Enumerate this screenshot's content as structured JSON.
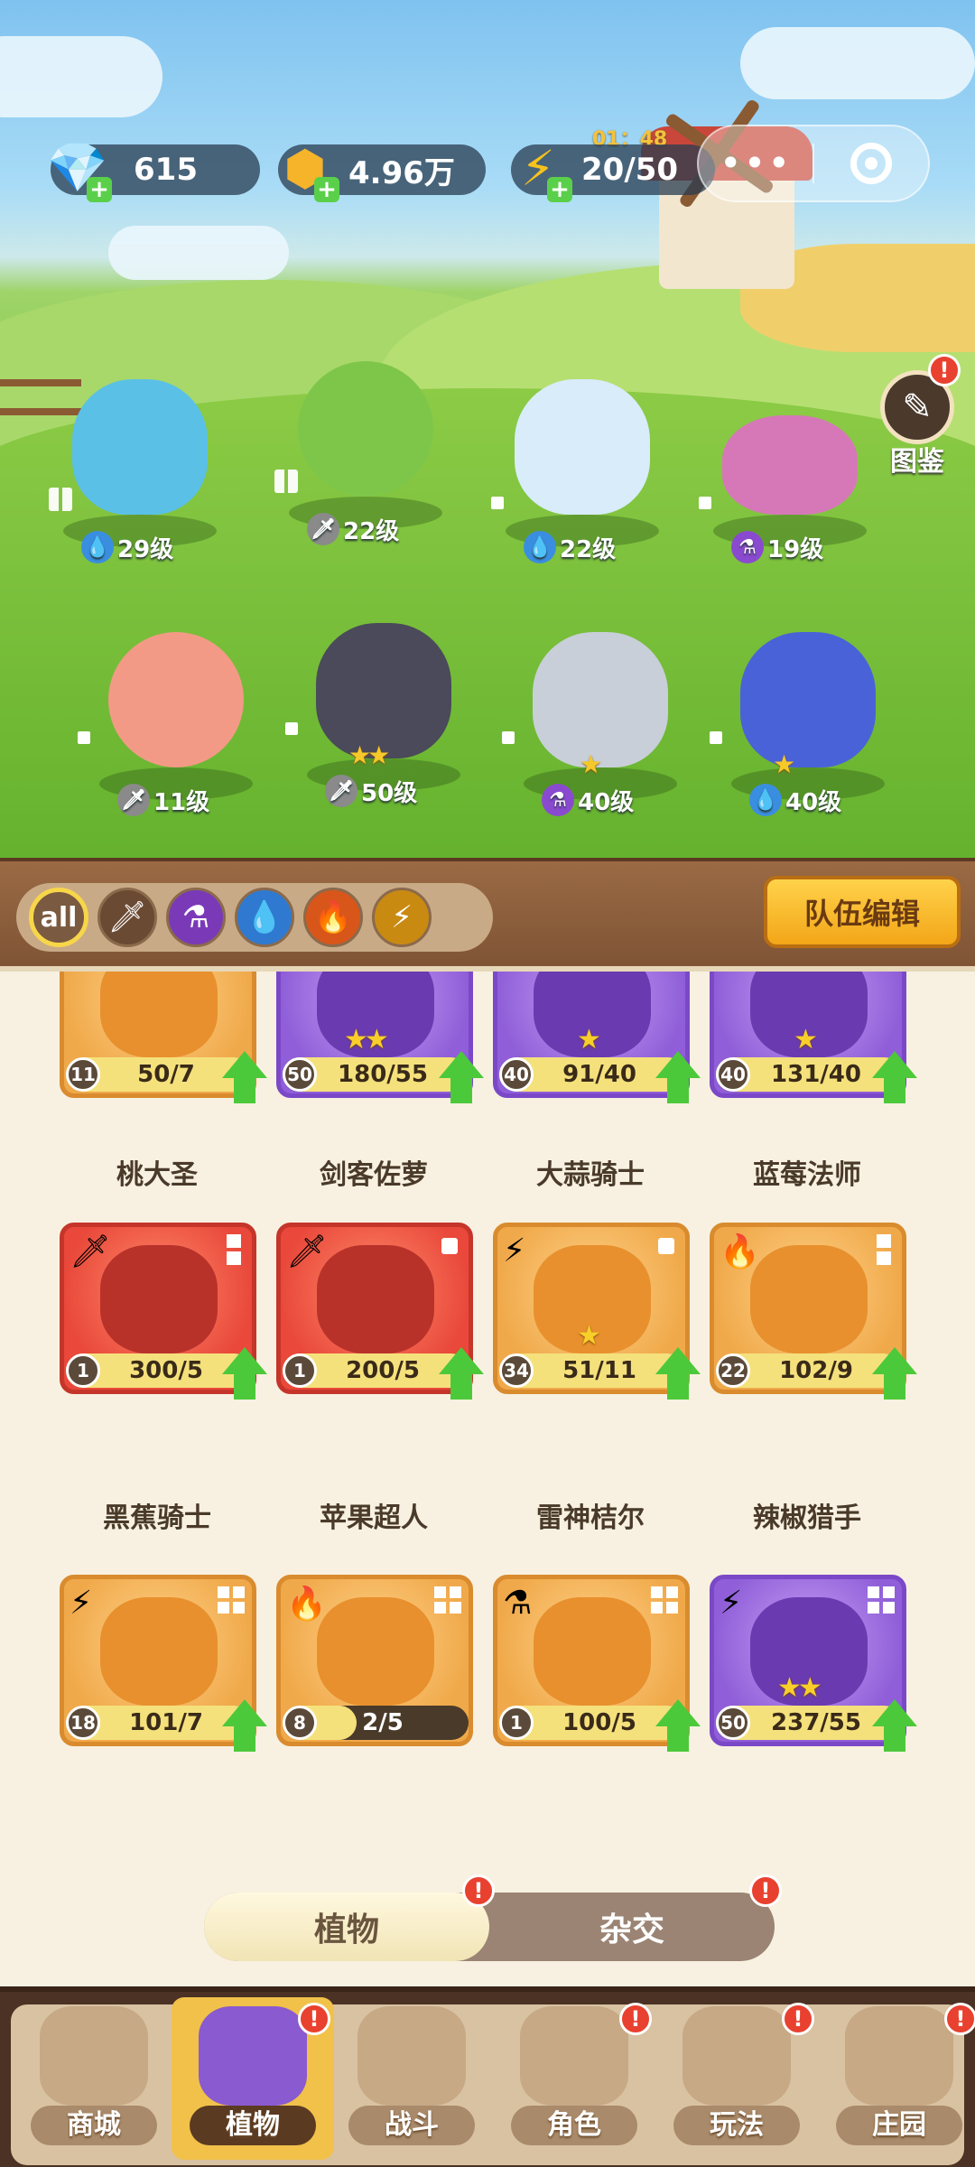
{
  "resources": {
    "gems": "615",
    "gold": "4.96万",
    "energy": "20/50",
    "energy_timer": "01：48"
  },
  "capsule": {
    "more": "•••"
  },
  "tujian": {
    "label": "图鉴",
    "badge": "!"
  },
  "heroes": [
    {
      "level": "29级",
      "element": "water"
    },
    {
      "level": "22级",
      "element": "sword"
    },
    {
      "level": "22级",
      "element": "water"
    },
    {
      "level": "19级",
      "element": "poison"
    },
    {
      "level": "11级",
      "element": "sword"
    },
    {
      "level": "50级",
      "element": "sword",
      "stars": 2
    },
    {
      "level": "40级",
      "element": "poison",
      "stars": 1
    },
    {
      "level": "40级",
      "element": "water",
      "stars": 1
    }
  ],
  "filters": {
    "all": "all",
    "items": [
      "sword",
      "poison",
      "water",
      "fire",
      "lightning"
    ]
  },
  "team_edit": "队伍编辑",
  "cards": [
    {
      "name": "桃大圣",
      "level": "11",
      "count": "50/7",
      "progress": 1.0,
      "color": "orange",
      "stars": 0
    },
    {
      "name": "剑客佐萝",
      "level": "50",
      "count": "180/55",
      "progress": 1.0,
      "color": "purple",
      "stars": 2
    },
    {
      "name": "大蒜骑士",
      "level": "40",
      "count": "91/40",
      "progress": 1.0,
      "color": "purple",
      "stars": 1
    },
    {
      "name": "蓝莓法师",
      "level": "40",
      "count": "131/40",
      "progress": 1.0,
      "color": "purple",
      "stars": 1
    },
    {
      "name": "黑蕉骑士",
      "level": "1",
      "count": "300/5",
      "progress": 1.0,
      "color": "red",
      "stars": 0,
      "element": "sword"
    },
    {
      "name": "苹果超人",
      "level": "1",
      "count": "200/5",
      "progress": 1.0,
      "color": "red",
      "stars": 0,
      "element": "sword"
    },
    {
      "name": "雷神桔尔",
      "level": "34",
      "count": "51/11",
      "progress": 1.0,
      "color": "orange",
      "stars": 1,
      "element": "lightning"
    },
    {
      "name": "辣椒猎手",
      "level": "22",
      "count": "102/9",
      "progress": 1.0,
      "color": "orange",
      "stars": 0,
      "element": "fire"
    },
    {
      "name": "",
      "level": "18",
      "count": "101/7",
      "progress": 1.0,
      "color": "orange",
      "stars": 0,
      "element": "lightning"
    },
    {
      "name": "",
      "level": "8",
      "count": "2/5",
      "progress": 0.4,
      "color": "orange",
      "stars": 0,
      "element": "fire"
    },
    {
      "name": "",
      "level": "1",
      "count": "100/5",
      "progress": 1.0,
      "color": "orange",
      "stars": 0,
      "element": "poison"
    },
    {
      "name": "",
      "level": "50",
      "count": "237/55",
      "progress": 1.0,
      "color": "purple",
      "stars": 2,
      "element": "lightning"
    }
  ],
  "toggle": {
    "plants": "植物",
    "hybrid": "杂交",
    "badge": "!"
  },
  "nav": [
    {
      "label": "商城",
      "badge": ""
    },
    {
      "label": "植物",
      "badge": "!"
    },
    {
      "label": "战斗",
      "badge": ""
    },
    {
      "label": "角色",
      "badge": "!"
    },
    {
      "label": "玩法",
      "badge": "!"
    },
    {
      "label": "庄园",
      "badge": "!"
    }
  ],
  "colors": {
    "accent": "#f3a618",
    "upgrade": "#4cc93a",
    "badge": "#e9412f"
  }
}
